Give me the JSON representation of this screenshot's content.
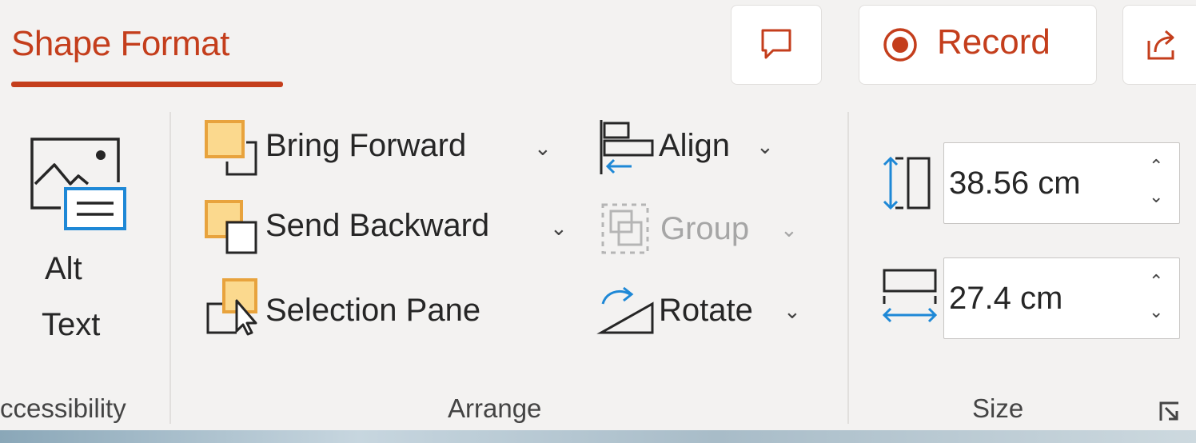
{
  "tab": {
    "label": "Shape Format"
  },
  "top_buttons": {
    "record_label": "Record"
  },
  "accessibility": {
    "alt_text_line1": "Alt",
    "alt_text_line2": "Text",
    "group_label": "ccessibility"
  },
  "arrange": {
    "bring_forward": "Bring Forward",
    "send_backward": "Send Backward",
    "selection_pane": "Selection Pane",
    "align": "Align",
    "group": "Group",
    "rotate": "Rotate",
    "group_label": "Arrange"
  },
  "size": {
    "height_value": "38.56 cm",
    "width_value": "27.4 cm",
    "group_label": "Size"
  },
  "colors": {
    "accent": "#c43e1c",
    "icon_orange": "#e8a33d",
    "icon_fill": "#fbd98e",
    "icon_blue": "#1e88d6"
  },
  "icons": [
    "comment-icon",
    "record-icon",
    "share-icon",
    "alt-text-icon",
    "bring-forward-icon",
    "send-backward-icon",
    "selection-pane-icon",
    "align-icon",
    "group-icon",
    "rotate-icon",
    "height-icon",
    "width-icon",
    "dialog-launcher-icon"
  ]
}
